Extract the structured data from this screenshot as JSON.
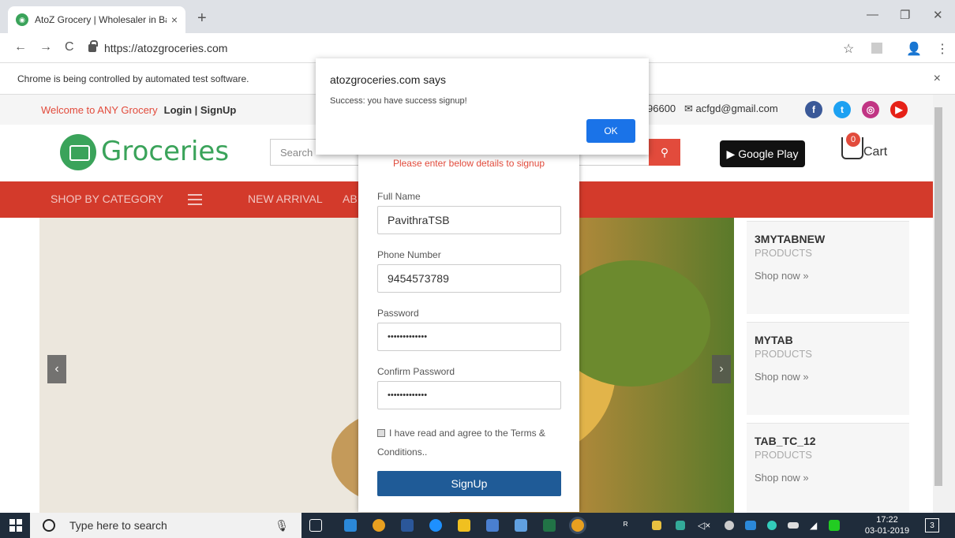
{
  "browser": {
    "tab_title": "AtoZ Grocery | Wholesaler in Ban",
    "tab_close": "×",
    "new_tab": "+",
    "url": "https://atozgroceries.com",
    "back": "←",
    "forward": "→",
    "reload": "C",
    "star": "☆",
    "profile": "👤",
    "menu": "⋮",
    "minimize": "—",
    "restore": "❐",
    "close": "✕",
    "automation_notice": "Chrome is being controlled by automated test software.",
    "infobar_close": "×"
  },
  "site": {
    "welcome": "Welcome to ANY Grocery",
    "auth_links": "Login | SignUp",
    "phone_partial": "96600",
    "email": "acfgd@gmail.com",
    "logo_text": "Groceries",
    "search_placeholder": "Search",
    "search_icon": "⚲",
    "google_play": "Google Play",
    "cart_count": "0",
    "cart_label": "Cart",
    "nav": {
      "shop_by_category": "SHOP BY CATEGORY",
      "new_arrival": "NEW ARRIVAL",
      "about_partial": "AB"
    },
    "carousel_prev": "‹",
    "carousel_next": "›",
    "side_cards": [
      {
        "title": "3MYTABNEW",
        "sub": "PRODUCTS",
        "link": "Shop now »"
      },
      {
        "title": "MYTAB",
        "sub": "PRODUCTS",
        "link": "Shop now »"
      },
      {
        "title": "TAB_TC_12",
        "sub": "PRODUCTS",
        "link": "Shop now »"
      }
    ]
  },
  "signup": {
    "instruction": "Please enter below details to signup",
    "full_name_label": "Full Name",
    "full_name_value": "PavithraTSB",
    "phone_label": "Phone Number",
    "phone_value": "9454573789",
    "password_label": "Password",
    "password_value": "•••••••••••••",
    "confirm_label": "Confirm Password",
    "confirm_value": "•••••••••••••",
    "agree_text": "I have read and agree to the Terms & Conditions..",
    "button": "SignUp"
  },
  "alert": {
    "title": "atozgroceries.com says",
    "message": "Success: you have success signup!",
    "ok": "OK"
  },
  "taskbar": {
    "search_text": "Type here to search",
    "time": "17:22",
    "date": "03-01-2019",
    "notifications": "3"
  },
  "colors": {
    "accent_red": "#d33a2b",
    "brand_green": "#3aa35a",
    "signup_blue": "#1f5b97",
    "alert_blue": "#1a73e8"
  }
}
